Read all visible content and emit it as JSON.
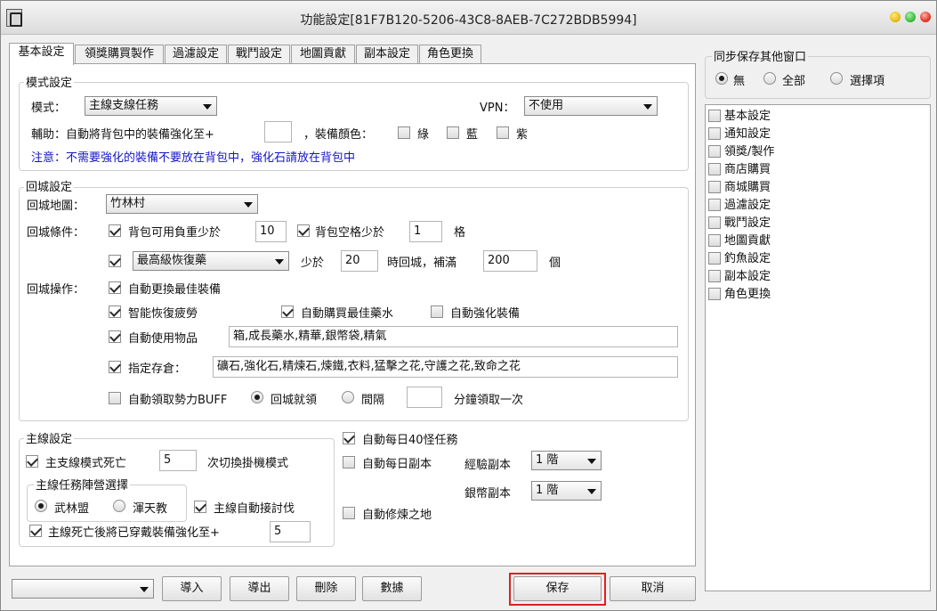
{
  "window": {
    "title": "功能設定[81F7B120-5206-43C8-8AEB-7C272BDB5994]"
  },
  "colors": {
    "note_text": "#1515c8",
    "titlebar_yellow": "#e8c018",
    "titlebar_green": "#3fbf3f",
    "titlebar_red": "#e23a2a",
    "save_highlight": "#e02020"
  },
  "tabs": [
    "基本設定",
    "領獎購買製作",
    "過濾設定",
    "戰鬥設定",
    "地圖貢獻",
    "副本設定",
    "角色更換"
  ],
  "mode_group": {
    "title": "模式設定",
    "mode_label": "模式：",
    "mode_value": "主線支線任務",
    "vpn_label": "VPN：",
    "vpn_value": "不使用",
    "assist_label": "輔助：自動將背包中的裝備強化至+",
    "assist_value": "",
    "equip_color_label": "，裝備顏色：",
    "color_green": "綠",
    "color_blue": "藍",
    "color_purple": "紫",
    "note": "注意：不需要強化的裝備不要放在背包中，強化石請放在背包中"
  },
  "return_group": {
    "title": "回城設定",
    "map_label": "回城地圖：",
    "map_value": "竹林村",
    "cond_label": "回城條件：",
    "weight_label": "背包可用負重少於",
    "weight_value": "10",
    "space_label": "背包空格少於",
    "space_value": "1",
    "space_unit": "格",
    "potion_value": "最高級恢復藥",
    "less_label": "少於",
    "less_value": "20",
    "refill_label": "時回城，補滿",
    "refill_value": "200",
    "refill_unit": "個",
    "ops_label": "回城操作：",
    "auto_best_equip": "自動更換最佳裝備",
    "smart_recover": "智能恢復疲勞",
    "auto_buy_potion": "自動購買最佳藥水",
    "auto_enhance": "自動強化裝備",
    "auto_use_items": "自動使用物品",
    "auto_use_items_value": "箱,成長藥水,精華,銀幣袋,精氣",
    "storage_label": "指定存倉：",
    "storage_value": "礦石,強化石,精煉石,煉鐵,衣料,猛擊之花,守護之花,致命之花",
    "buff_label": "自動領取勢力BUFF",
    "on_return": "回城就領",
    "interval": "間隔",
    "interval_value": "",
    "interval_unit": "分鐘領取一次"
  },
  "main_group": {
    "title": "主線設定",
    "death_label": "主支線模式死亡",
    "death_value": "5",
    "death_suffix": "次切換掛機模式",
    "faction_title": "主線任務陣營選擇",
    "faction_a": "武林盟",
    "faction_b": "渾天教",
    "auto_accept": "主線自動接討伐",
    "death_enhance_label": "主線死亡後將已穿戴裝備強化至+",
    "death_enhance_value": "5"
  },
  "right_opts": {
    "daily_40": "自動每日40怪任務",
    "daily_dungeon": "自動每日副本",
    "exp_dungeon_label": "經驗副本",
    "exp_dungeon_value": "1 階",
    "silver_dungeon_label": "銀幣副本",
    "silver_dungeon_value": "1 階",
    "training_ground": "自動修煉之地"
  },
  "sync": {
    "title": "同步保存其他窗口",
    "opt_none": "無",
    "opt_all": "全部",
    "opt_select": "選擇項",
    "items": [
      "基本設定",
      "通知設定",
      "領獎/製作",
      "商店購買",
      "商城購買",
      "過濾設定",
      "戰鬥設定",
      "地圖貢獻",
      "釣魚設定",
      "副本設定",
      "角色更換"
    ]
  },
  "bottom": {
    "profile_value": "",
    "import": "導入",
    "export": "導出",
    "delete": "刪除",
    "data": "數據",
    "save": "保存",
    "cancel": "取消"
  },
  "checks": {
    "weight": true,
    "space": true,
    "potion": true,
    "auto_best_equip": true,
    "smart_recover": true,
    "auto_buy_potion": true,
    "auto_enhance": false,
    "auto_use_items": true,
    "storage": true,
    "buff": false,
    "death_switch": true,
    "auto_accept": true,
    "death_enhance": true,
    "daily_40": true,
    "daily_dungeon": false,
    "training_ground": false,
    "green": false,
    "blue": false,
    "purple": false
  }
}
